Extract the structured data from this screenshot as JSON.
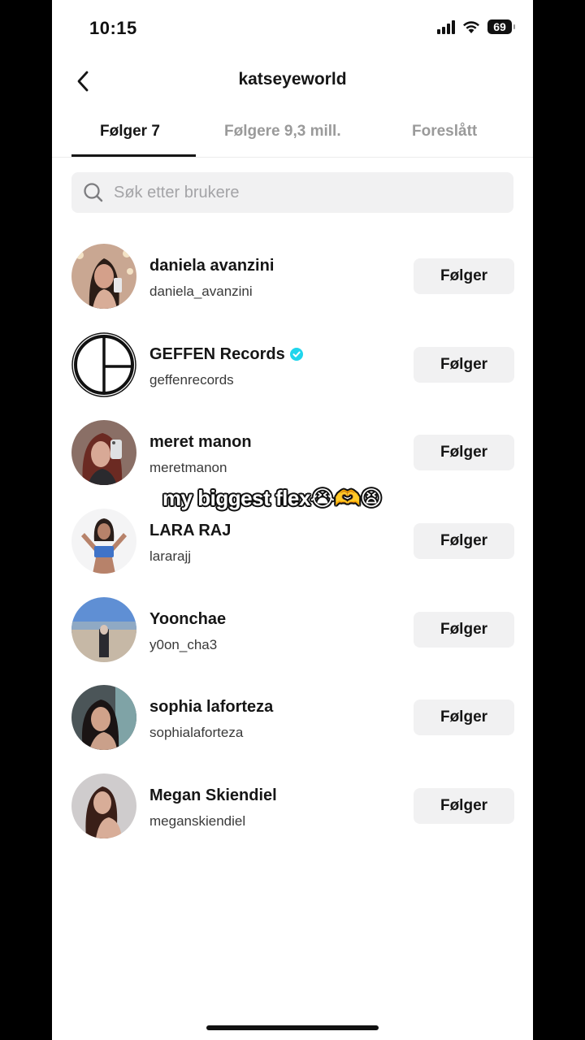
{
  "status_bar": {
    "time": "10:15",
    "battery": "69"
  },
  "header": {
    "title": "katseyeworld"
  },
  "tabs": [
    {
      "label": "Følger 7",
      "active": true
    },
    {
      "label": "Følgere 9,3 mill.",
      "active": false
    },
    {
      "label": "Foreslått",
      "active": false
    }
  ],
  "search": {
    "placeholder": "Søk etter brukere",
    "value": ""
  },
  "users": [
    {
      "name": "daniela avanzini",
      "handle": "daniela_avanzini",
      "button": "Følger",
      "verified": false
    },
    {
      "name": "GEFFEN Records",
      "handle": "geffenrecords",
      "button": "Følger",
      "verified": true
    },
    {
      "name": "meret manon",
      "handle": "meretmanon",
      "button": "Følger",
      "verified": false
    },
    {
      "name": "LARA RAJ",
      "handle": "lararajj",
      "button": "Følger",
      "verified": false
    },
    {
      "name": "Yoonchae",
      "handle": "y0on_cha3",
      "button": "Følger",
      "verified": false
    },
    {
      "name": "sophia laforteza",
      "handle": "sophialaforteza",
      "button": "Følger",
      "verified": false
    },
    {
      "name": "Megan Skiendiel",
      "handle": "meganskiendiel",
      "button": "Følger",
      "verified": false
    }
  ],
  "overlay": {
    "caption": "my biggest flex😭🫶😫"
  },
  "colors": {
    "accent": "#161616",
    "verified": "#20d5ec",
    "button_bg": "#f1f1f2",
    "muted": "#9a9a9a"
  }
}
